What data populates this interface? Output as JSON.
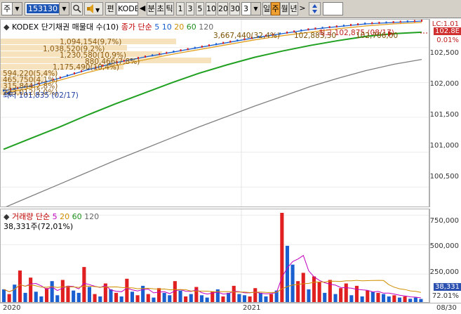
{
  "toolbar": {
    "market_label": "주",
    "code_value": "153130",
    "edit_label": "편",
    "name_value": "KODE",
    "period_buttons": [
      "분",
      "초",
      "틱"
    ],
    "number_buttons": [
      "1",
      "3",
      "5",
      "10",
      "20",
      "30"
    ],
    "count_value": "3",
    "range_buttons": [
      "일",
      "주",
      "월",
      "년"
    ],
    "active_range": "주"
  },
  "price_panel": {
    "title": "KODEX 단기채권 매물대 수(10)",
    "ma_label": "종가 단순",
    "ma_periods": [
      "5",
      "10",
      "20",
      "60",
      "120"
    ],
    "high_note": "최고 102,875 (08/17)",
    "low_note": "최저 101,835 (02/17)",
    "gain_note": "3,667,440(32,4%)",
    "gain_price": "102,883,30",
    "right_price": "102,706,00",
    "volume_profile": [
      "1,094,154(9,7%)",
      "1,038,520(9,2%)",
      "1,230,580(10,9%)",
      "880,466(7,8%)",
      "1,175,490(10,4%)",
      "594,220(5,4%)",
      "465,750(4,1%)",
      "315,844(2,8%)",
      "223,012(2,0%)"
    ],
    "axis_labels": [
      "102,500",
      "102,000",
      "101,500",
      "101,000",
      "100,500"
    ],
    "current_price_box": "102.8E",
    "lc_label": "LC:1.01",
    "pct_label": "0.01%"
  },
  "volume_panel": {
    "title": "거래량",
    "ma_label": "단순",
    "ma_periods": [
      "5",
      "20",
      "60",
      "120"
    ],
    "volume_note": "38,331주(72,01%)",
    "axis_labels": [
      "750,000",
      "500,000",
      "250,000"
    ],
    "current_volume_box": "38,331",
    "pct_label": "72.01%"
  },
  "x_axis": {
    "labels": [
      "2020",
      "2021",
      "08/30"
    ]
  },
  "colors": {
    "up_bar": "#e02020",
    "down_bar": "#1a5fd0",
    "ma5": "#1a5fd0",
    "ma10": "#1a5fd0",
    "ma20": "#e0a020",
    "ma60": "#20a020",
    "ma120": "#808080",
    "profile": "#f5deb3"
  },
  "chart_data": [
    {
      "type": "line",
      "title": "KODEX 단기채권 매물대 수(10)",
      "xlabel": "",
      "ylabel": "",
      "ylim": [
        100200,
        102900
      ],
      "x_labels": [
        "2020",
        "2021"
      ],
      "series": [
        {
          "name": "5",
          "values": [
            101880,
            101950,
            102060,
            102180,
            102280,
            102360,
            102430,
            102500,
            102570,
            102640,
            102700,
            102760,
            102800,
            102840,
            102860,
            102880
          ]
        },
        {
          "name": "20",
          "values": [
            101850,
            101920,
            102030,
            102140,
            102240,
            102320,
            102400,
            102470,
            102540,
            102610,
            102670,
            102720,
            102770,
            102810,
            102840,
            102860
          ]
        },
        {
          "name": "60",
          "values": [
            101040,
            101200,
            101360,
            101530,
            101690,
            101840,
            101990,
            102130,
            102250,
            102360,
            102450,
            102530,
            102600,
            102660,
            102700,
            102720
          ]
        },
        {
          "name": "120",
          "values": [
            100200,
            100370,
            100540,
            100710,
            100880,
            101040,
            101200,
            101360,
            101510,
            101660,
            101800,
            101940,
            102060,
            102170,
            102260,
            102330
          ]
        }
      ]
    },
    {
      "type": "bar",
      "title": "거래량",
      "ylim": [
        0,
        800000
      ],
      "values": [
        120000,
        80000,
        160000,
        280000,
        90000,
        220000,
        100000,
        60000,
        130000,
        190000,
        70000,
        200000,
        150000,
        110000,
        90000,
        310000,
        140000,
        80000,
        60000,
        170000,
        120000,
        90000,
        60000,
        210000,
        100000,
        70000,
        150000,
        80000,
        50000,
        130000,
        90000,
        70000,
        190000,
        110000,
        60000,
        80000,
        140000,
        70000,
        50000,
        100000,
        120000,
        60000,
        90000,
        150000,
        80000,
        70000,
        60000,
        130000,
        90000,
        60000,
        80000,
        110000,
        770000,
        490000,
        330000,
        190000,
        260000,
        120000,
        230000,
        180000,
        90000,
        200000,
        80000,
        130000,
        170000,
        70000,
        150000,
        60000,
        110000,
        100000,
        90000,
        80000,
        60000,
        70000,
        50000,
        60000,
        40000,
        50000,
        38331
      ],
      "up": [
        false,
        true,
        false,
        true,
        false,
        true,
        false,
        false,
        true,
        false,
        false,
        true,
        true,
        false,
        false,
        true,
        false,
        true,
        false,
        true,
        false,
        true,
        false,
        true,
        false,
        true,
        false,
        true,
        false,
        true,
        false,
        false,
        true,
        false,
        true,
        false,
        true,
        false,
        false,
        true,
        false,
        true,
        false,
        true,
        false,
        false,
        true,
        true,
        false,
        false,
        true,
        false,
        true,
        false,
        false,
        true,
        true,
        false,
        true,
        true,
        false,
        true,
        false,
        true,
        true,
        false,
        true,
        false,
        true,
        false,
        true,
        false,
        false,
        true,
        false,
        true,
        false,
        false,
        false
      ]
    }
  ]
}
